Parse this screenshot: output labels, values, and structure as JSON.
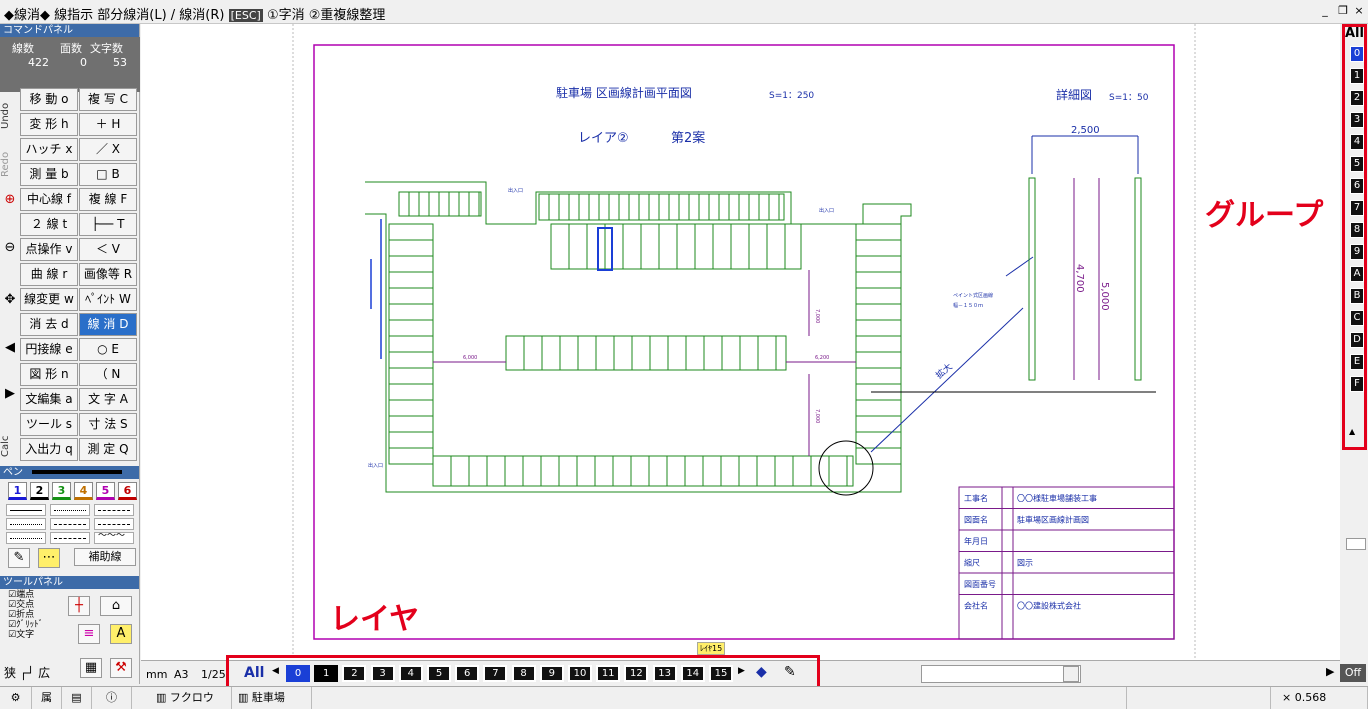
{
  "titlebar": {
    "mode": "◆線消◆",
    "hint": "線指示 部分線消(L) / 線消(R)",
    "esc": "[ESC]",
    "opts": "①字消 ②重複線整理",
    "btn_min": "_",
    "btn_restore": "❐",
    "btn_close": "×"
  },
  "left_panel": {
    "header": "コマンドパネル",
    "counts": {
      "lines_label": "線数",
      "faces_label": "面数",
      "chars_label": "文字数",
      "lines": "422",
      "faces": "0",
      "chars": "53"
    },
    "side_tabs": [
      "Undo",
      "Redo",
      "Calc"
    ],
    "commands": [
      [
        "移 動 o",
        "複 写 C"
      ],
      [
        "変 形 h",
        "＋ H"
      ],
      [
        "ハッチ x",
        "／ X"
      ],
      [
        "測 量 b",
        "□ B"
      ],
      [
        "中心線 f",
        "複 線 F"
      ],
      [
        "２ 線 t",
        "├── T"
      ],
      [
        "点操作 v",
        "＜ V"
      ],
      [
        "曲 線 r",
        "画像等 R"
      ],
      [
        "線変更 w",
        "ﾍﾟｲﾝﾄ W"
      ],
      [
        "消 去 d",
        "線 消 D"
      ],
      [
        "円接線 e",
        "○ E"
      ],
      [
        "図 形 n",
        "（ N"
      ],
      [
        "文編集 a",
        "文 字 A"
      ],
      [
        "ツール s",
        "寸 法 S"
      ],
      [
        "入出力 q",
        "測 定 Q"
      ]
    ],
    "pen_header": "ペン",
    "pens": [
      "1",
      "2",
      "3",
      "4",
      "5",
      "6"
    ],
    "pen_colors": [
      "#1a1ad6",
      "#000000",
      "#159015",
      "#c07000",
      "#b000b0",
      "#c00000"
    ],
    "aux_label": "補助線",
    "tool_header": "ツールパネル",
    "snap": [
      "端点",
      "交点",
      "折点",
      "ｸﾞﾘｯﾄﾞ",
      "文字"
    ],
    "zoom_narrow": "狭",
    "zoom_wide": "広",
    "unit": "mm",
    "paper": "A3",
    "scale": "1/25"
  },
  "drawing": {
    "title": "駐車場 区画線計画平面図",
    "scale_main": "S=1：250",
    "subtitle": "レイア②",
    "plan": "第2案",
    "detail_title": "詳細図",
    "detail_scale": "S=1：50",
    "dim_top": "2,500",
    "dim_inner": "4,700",
    "dim_outer": "5,000",
    "paint_note1": "ペイント式区画線",
    "paint_note2": "幅－１５０ｍ",
    "enlarge": "拡大",
    "entrance": "出入口",
    "dim_a": "6,000",
    "dim_b": "6,200",
    "dim_c": "7,000",
    "table": [
      [
        "工事名",
        "〇〇様駐車場舗装工事"
      ],
      [
        "図面名",
        "駐車場区画線計画図"
      ],
      [
        "年月日",
        ""
      ],
      [
        "縮尺",
        "図示"
      ],
      [
        "図面番号",
        ""
      ],
      [
        "会社名",
        "〇〇建設株式会社"
      ]
    ]
  },
  "groups": {
    "all": "All",
    "items": [
      "0",
      "1",
      "2",
      "3",
      "4",
      "5",
      "6",
      "7",
      "8",
      "9",
      "A",
      "B",
      "C",
      "D",
      "E",
      "F"
    ],
    "annotation": "グループ",
    "scroll_up": "▲"
  },
  "layers": {
    "all": "All",
    "items": [
      "0",
      "1",
      "2",
      "3",
      "4",
      "5",
      "6",
      "7",
      "8",
      "9",
      "10",
      "11",
      "12",
      "13",
      "14",
      "15"
    ],
    "annotation": "レイヤ",
    "tooltip": "ﾚｲﾔ15",
    "off": "Off"
  },
  "status": {
    "tab1": "フクロウ",
    "tab2": "駐車場",
    "ratio": "× 0.568",
    "layer_label": "属"
  }
}
